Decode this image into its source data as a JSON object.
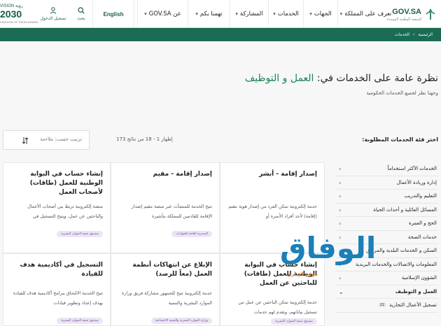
{
  "header": {
    "logo": {
      "name": "GOV.SA",
      "sub": "المنصة الوطنية الموحدة"
    },
    "nav": [
      "تعرف على المملكة",
      "الجهات",
      "الخدمات",
      "المشاركة",
      "تهمنا بكم",
      "عن GOV.SA"
    ],
    "english": "English",
    "search": "بحث",
    "login": "تسجيل الدخول",
    "vision": {
      "top": "VISION رؤية",
      "year": "2030",
      "country": "KINGDOM OF SAUDI ARABIA"
    }
  },
  "breadcrumb": [
    "الرئيسية",
    "الخدمات"
  ],
  "page": {
    "title_prefix": "نظرة عامة على الخدمات في:",
    "title_accent": "العمل و التوظيف",
    "subtitle": "وجهنا نظر لجميع الخدمات الحكومية"
  },
  "filters": {
    "title": "اختر فئة الخدمات المطلوبة:",
    "results": "إظهار 1 - 18 من نتائج 173",
    "sort_label": "ترتيب حسب: ملاءمة"
  },
  "categories": [
    {
      "label": "الخدمات الأكثر استخداماً",
      "count": ""
    },
    {
      "label": "إدارة وريادة الأعمال",
      "count": ""
    },
    {
      "label": "التعليم والتدريب",
      "count": ""
    },
    {
      "label": "المسائل العائلية و أحداث الحياة",
      "count": ""
    },
    {
      "label": "الحج و العمرة",
      "count": ""
    },
    {
      "label": "خدمات الصحة",
      "count": ""
    },
    {
      "label": "السكن و الخدمات البلدية والمرافق",
      "count": ""
    },
    {
      "label": "المعلومات والاتصالات والخدمات البريدية",
      "count": ""
    },
    {
      "label": "الشؤون الإسلامية",
      "count": ""
    },
    {
      "label": "العمل و التوظيف",
      "count": "",
      "active": true
    },
    {
      "label": "تسجيل الأعمال التجارية",
      "count": "22"
    }
  ],
  "cards": [
    {
      "title": "إصدار إقامة - أبشر",
      "desc": "خدمة إلكترونية تمكن الفرد من إصدار هوية مقيم (إقامة) لأحد أفراد الأسرة أو",
      "tag": ""
    },
    {
      "title": "إصدار إقامة - مقيم",
      "desc": "تتيح الخدمة للمنشآت عبر منصة مقيم إصدار الإقامة للقادمين للمملكة بتأشيرة",
      "tag": "المديرية العامة للجوازات"
    },
    {
      "title": "إنشاء حساب في البوابة الوطنية للعمل (طاقات) لأصحاب العمل",
      "desc": "منصة إلكترونية تربط بين أصحاب الأعمال والباحثين عن عمل، ويتيح التسجيل في",
      "tag": "صندوق تنمية الموارد البشرية"
    },
    {
      "title": "إنشاء حساب في البوابة الوطنية للعمل (طاقات) للباحثين عن العمل",
      "desc": "خدمة إلكترونية تمكن الباحثين عن عمل من تسجيل بياناتهم، وتقدم لهم خدمات",
      "tag": "صندوق تنمية الموارد البشرية"
    },
    {
      "title": "الإبلاغ عن انتهاكات أنظمة العمل (معاً للرصد)",
      "desc": "خدمة إلكترونية تتيح للجمهور مشاركة فريق وزارة الموارد البشرية والتنمية",
      "tag": "وزارة الموارد البشرية والتنمية الاجتماعية"
    },
    {
      "title": "التسجيل في أكاديمية هدف للقيادة",
      "desc": "تتيح الخدمة الالتحاق ببرامج أكاديمية هدف للقيادة بهدف إعداد وتطوير قيادات",
      "tag": "صندوق تنمية الموارد البشرية"
    }
  ],
  "watermark": {
    "text": "الوفاق",
    "sub": "موقع اخباري"
  },
  "colors": {
    "primary": "#1b6b54",
    "accent": "#1b8354",
    "tag_bg": "#ece4f5",
    "watermark": "#1b7fb8"
  }
}
